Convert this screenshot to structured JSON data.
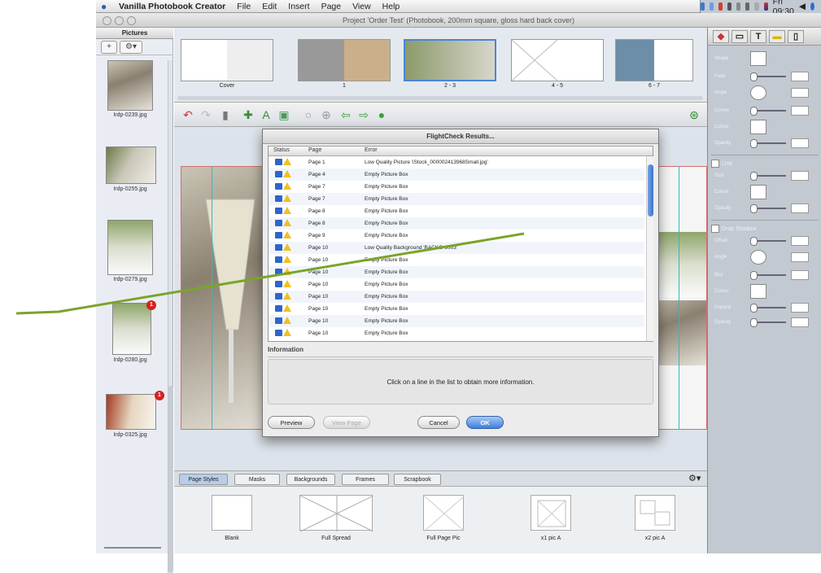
{
  "menubar": {
    "app_name": "Vanilla Photobook Creator",
    "items": [
      "File",
      "Edit",
      "Insert",
      "Page",
      "View",
      "Help"
    ],
    "clock": "Fri 09:30"
  },
  "window": {
    "title": "Project 'Order Test' (Photobook, 200mm square, gloss hard back cover)"
  },
  "pictures_panel": {
    "title": "Pictures",
    "add": "+",
    "tools": "⚙▾",
    "items": [
      {
        "file": "Irdp-0239.jpg"
      },
      {
        "file": "Irdp-0255.jpg"
      },
      {
        "file": "Irdp-0279.jpg"
      },
      {
        "file": "Irdp-0280.jpg",
        "badge": "1"
      },
      {
        "file": "Irdp-0325.jpg",
        "badge": "1"
      }
    ]
  },
  "spreads": [
    "Cover",
    "1",
    "2 - 3",
    "4 - 5",
    "6 - 7"
  ],
  "bottom_tabs": [
    "Page Styles",
    "Masks",
    "Backgrounds",
    "Frames",
    "Scrapbook"
  ],
  "page_styles": [
    "Blank",
    "Full Spread",
    "Full Page Pic",
    "x1 pic A",
    "x2 pic A"
  ],
  "dialog": {
    "title": "FlightCheck Results...",
    "columns": {
      "status": "Status",
      "page": "Page",
      "error": "Error"
    },
    "rows": [
      {
        "page": "Page 1",
        "error": "Low Quality Picture 'iStock_000002413968Small.jpg'"
      },
      {
        "page": "Page 4",
        "error": "Empty Picture Box"
      },
      {
        "page": "Page 7",
        "error": "Empty Picture Box"
      },
      {
        "page": "Page 7",
        "error": "Empty Picture Box"
      },
      {
        "page": "Page 8",
        "error": "Empty Picture Box"
      },
      {
        "page": "Page 8",
        "error": "Empty Picture Box"
      },
      {
        "page": "Page 9",
        "error": "Empty Picture Box"
      },
      {
        "page": "Page 10",
        "error": "Low Quality Background 'BACKG-9003'"
      },
      {
        "page": "Page 10",
        "error": "Empty Picture Box"
      },
      {
        "page": "Page 10",
        "error": "Empty Picture Box"
      },
      {
        "page": "Page 10",
        "error": "Empty Picture Box"
      },
      {
        "page": "Page 10",
        "error": "Empty Picture Box"
      },
      {
        "page": "Page 10",
        "error": "Empty Picture Box"
      },
      {
        "page": "Page 10",
        "error": "Empty Picture Box"
      },
      {
        "page": "Page 10",
        "error": "Empty Picture Box"
      }
    ],
    "info_label": "Information",
    "info_text": "Click on a line in the list to obtain more information.",
    "buttons": {
      "preview": "Preview",
      "view_page": "View Page",
      "cancel": "Cancel",
      "ok": "OK"
    }
  },
  "inspector": {
    "rows_a": [
      "Shape",
      "Fade",
      "Angle",
      "Corner",
      "Colour",
      "Opacity"
    ],
    "line_label": "Line",
    "rows_b": [
      "Size",
      "Colour",
      "Opacity"
    ],
    "shadow_label": "Drop Shadow",
    "rows_c": [
      "Offset",
      "Angle",
      "Blur",
      "Colour",
      "Expand",
      "Opacity"
    ]
  },
  "colors": {
    "accent": "#3f7fdc",
    "warn": "#f0c020",
    "annotation": "#7aa42a",
    "badge": "#d5221f"
  }
}
